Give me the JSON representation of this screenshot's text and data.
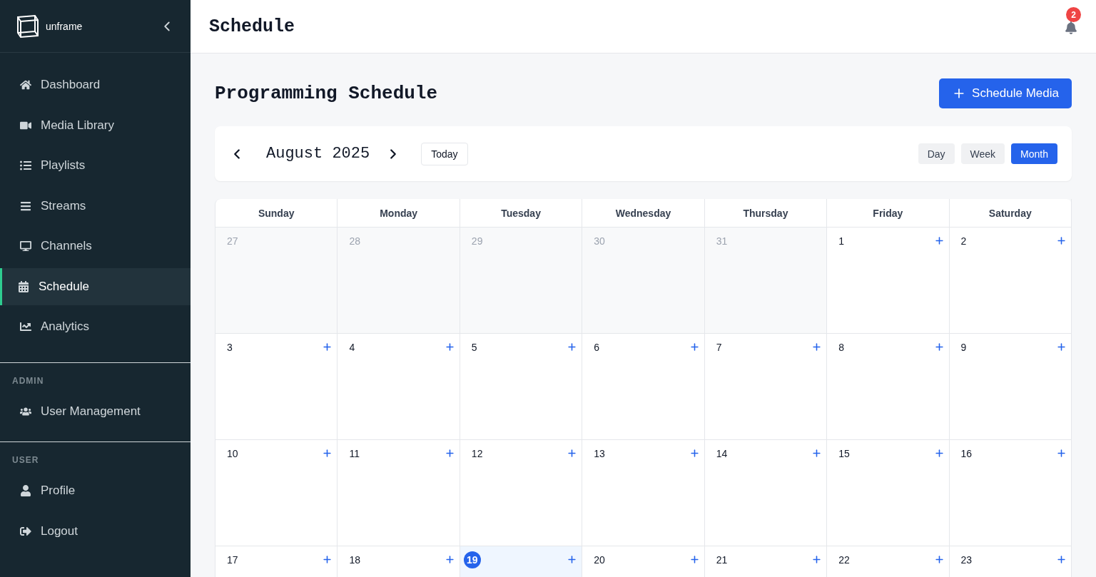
{
  "sidebar": {
    "brand": "unframe",
    "items": [
      {
        "label": "Dashboard",
        "selected": false
      },
      {
        "label": "Media Library",
        "selected": false
      },
      {
        "label": "Playlists",
        "selected": false
      },
      {
        "label": "Streams",
        "selected": false
      },
      {
        "label": "Channels",
        "selected": false
      },
      {
        "label": "Schedule",
        "selected": true
      },
      {
        "label": "Analytics",
        "selected": false
      }
    ],
    "sections": [
      {
        "title": "ADMIN",
        "items": [
          {
            "label": "User Management",
            "selected": false
          }
        ]
      },
      {
        "title": "USER",
        "items": [
          {
            "label": "Profile",
            "selected": false
          },
          {
            "label": "Logout",
            "selected": false
          }
        ]
      }
    ]
  },
  "header": {
    "title": "Schedule",
    "notifications": "2"
  },
  "page": {
    "title": "Programming Schedule",
    "action": "Schedule Media"
  },
  "toolbar": {
    "month": "August 2025",
    "today": "Today",
    "views": [
      {
        "label": "Day",
        "selected": false
      },
      {
        "label": "Week",
        "selected": false
      },
      {
        "label": "Month",
        "selected": true
      }
    ]
  },
  "calendar": {
    "weekdays": [
      "Sunday",
      "Monday",
      "Tuesday",
      "Wednesday",
      "Thursday",
      "Friday",
      "Saturday"
    ],
    "weeks": [
      [
        {
          "day": "27",
          "outside": true,
          "today": false
        },
        {
          "day": "28",
          "outside": true,
          "today": false
        },
        {
          "day": "29",
          "outside": true,
          "today": false
        },
        {
          "day": "30",
          "outside": true,
          "today": false
        },
        {
          "day": "31",
          "outside": true,
          "today": false
        },
        {
          "day": "1",
          "outside": false,
          "today": false
        },
        {
          "day": "2",
          "outside": false,
          "today": false
        }
      ],
      [
        {
          "day": "3",
          "outside": false,
          "today": false
        },
        {
          "day": "4",
          "outside": false,
          "today": false
        },
        {
          "day": "5",
          "outside": false,
          "today": false
        },
        {
          "day": "6",
          "outside": false,
          "today": false
        },
        {
          "day": "7",
          "outside": false,
          "today": false
        },
        {
          "day": "8",
          "outside": false,
          "today": false
        },
        {
          "day": "9",
          "outside": false,
          "today": false
        }
      ],
      [
        {
          "day": "10",
          "outside": false,
          "today": false
        },
        {
          "day": "11",
          "outside": false,
          "today": false
        },
        {
          "day": "12",
          "outside": false,
          "today": false
        },
        {
          "day": "13",
          "outside": false,
          "today": false
        },
        {
          "day": "14",
          "outside": false,
          "today": false
        },
        {
          "day": "15",
          "outside": false,
          "today": false
        },
        {
          "day": "16",
          "outside": false,
          "today": false
        }
      ],
      [
        {
          "day": "17",
          "outside": false,
          "today": false
        },
        {
          "day": "18",
          "outside": false,
          "today": false
        },
        {
          "day": "19",
          "outside": false,
          "today": true
        },
        {
          "day": "20",
          "outside": false,
          "today": false
        },
        {
          "day": "21",
          "outside": false,
          "today": false
        },
        {
          "day": "22",
          "outside": false,
          "today": false
        },
        {
          "day": "23",
          "outside": false,
          "today": false
        }
      ]
    ]
  }
}
